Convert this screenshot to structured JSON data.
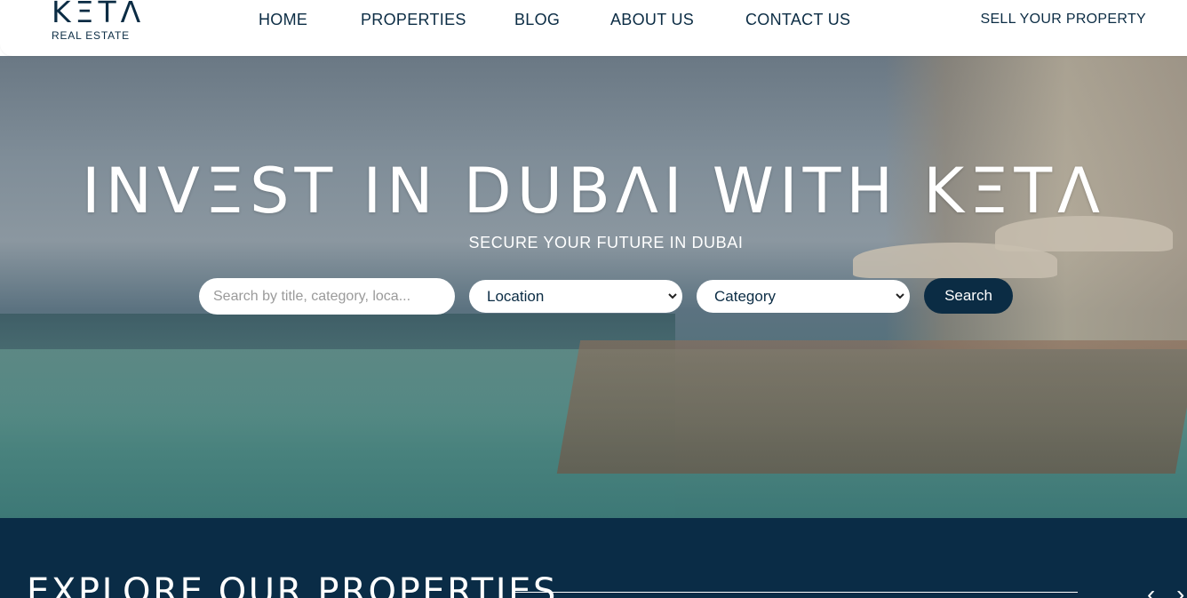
{
  "brand": {
    "logo_word": "KΞTΛ",
    "logo_sub": "REAL ESTATE"
  },
  "nav": {
    "items": [
      {
        "label": "HOME"
      },
      {
        "label": "PROPERTIES"
      },
      {
        "label": "BLOG"
      },
      {
        "label": "ABOUT US"
      },
      {
        "label": "CONTACT US"
      }
    ],
    "sell_label": "SELL YOUR PROPERTY"
  },
  "hero": {
    "title": "INVΞST IN DUBΛI WITH KΞTΛ",
    "subtitle": "SECURE YOUR FUTURE IN DUBAI"
  },
  "search": {
    "placeholder": "Search by title, category, loca...",
    "location_value": "Location",
    "category_value": "Category",
    "button_label": "Search"
  },
  "explore": {
    "title": "EXPLORE OUR PROPERTIES",
    "prev_icon": "‹",
    "next_icon": "›"
  },
  "colors": {
    "navy": "#0b2c44",
    "explore_bg": "#0a2c46",
    "white": "#ffffff"
  }
}
